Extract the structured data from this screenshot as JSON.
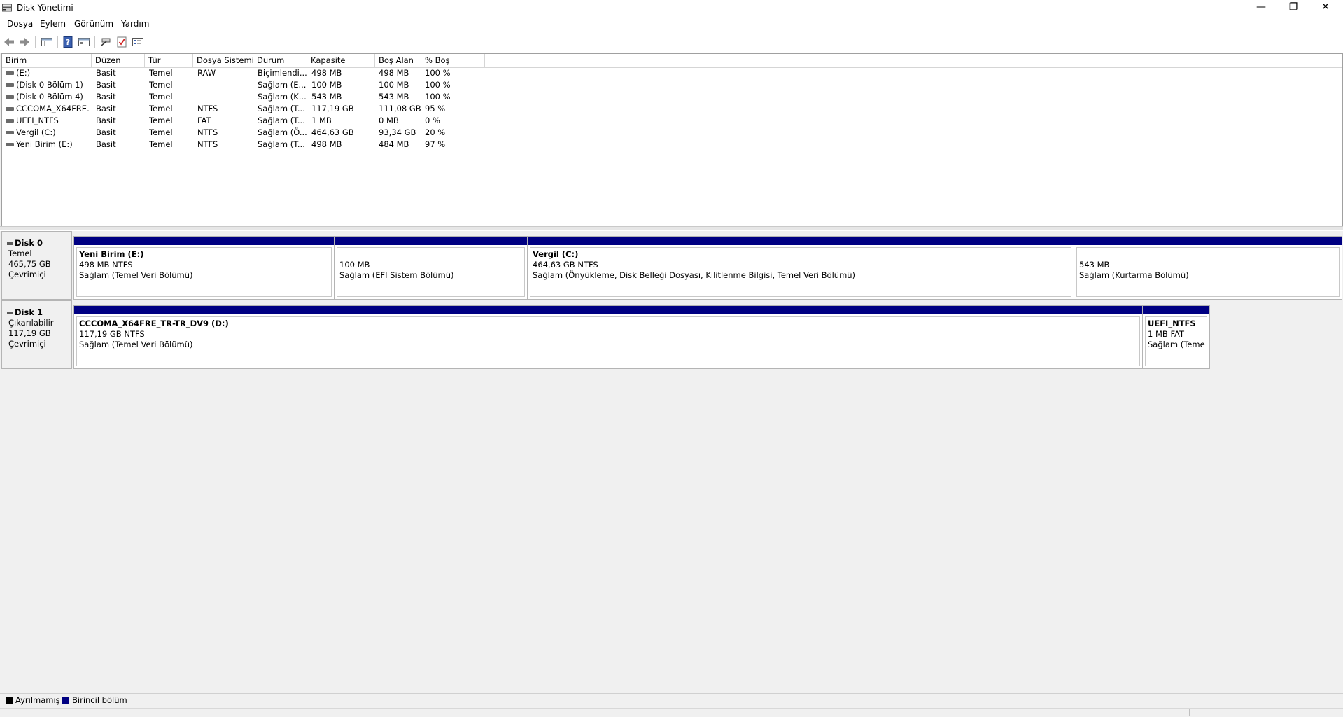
{
  "window": {
    "title": "Disk Yönetimi",
    "minimize_glyph": "—",
    "restore_glyph": "❐",
    "close_glyph": "✕"
  },
  "menu": [
    "Dosya",
    "Eylem",
    "Görünüm",
    "Yardım"
  ],
  "toolbar": {
    "icons": [
      "back-icon",
      "forward-icon",
      "console-tree-icon",
      "help-icon",
      "properties-icon",
      "connect-icon",
      "check-icon",
      "settings-list-icon"
    ]
  },
  "volume_list": {
    "columns": [
      "Birim",
      "Düzen",
      "Tür",
      "Dosya Sistemi",
      "Durum",
      "Kapasite",
      "Boş Alan",
      "% Boş"
    ],
    "rows": [
      [
        "(E:)",
        "Basit",
        "Temel",
        "RAW",
        "Biçimlendi...",
        "498 MB",
        "498 MB",
        "100 %"
      ],
      [
        "(Disk 0 Bölüm 1)",
        "Basit",
        "Temel",
        "",
        "Sağlam (E...",
        "100 MB",
        "100 MB",
        "100 %"
      ],
      [
        "(Disk 0 Bölüm 4)",
        "Basit",
        "Temel",
        "",
        "Sağlam (K...",
        "543 MB",
        "543 MB",
        "100 %"
      ],
      [
        "CCCOMA_X64FRE...",
        "Basit",
        "Temel",
        "NTFS",
        "Sağlam (T...",
        "117,19 GB",
        "111,08 GB",
        "95 %"
      ],
      [
        "UEFI_NTFS",
        "Basit",
        "Temel",
        "FAT",
        "Sağlam (T...",
        "1 MB",
        "0 MB",
        "0 %"
      ],
      [
        "Vergil (C:)",
        "Basit",
        "Temel",
        "NTFS",
        "Sağlam (Ö...",
        "464,63 GB",
        "93,34 GB",
        "20 %"
      ],
      [
        "Yeni Birim (E:)",
        "Basit",
        "Temel",
        "NTFS",
        "Sağlam (T...",
        "498 MB",
        "484 MB",
        "97 %"
      ]
    ]
  },
  "disks": [
    {
      "name": "Disk 0",
      "type": "Temel",
      "size": "465,75 GB",
      "status": "Çevrimiçi",
      "partitions": [
        {
          "title": "Yeni Birim  (E:)",
          "size_fs": "498 MB NTFS",
          "status": "Sağlam (Temel Veri Bölümü)"
        },
        {
          "title": "",
          "size_fs": "100 MB",
          "status": "Sağlam (EFI Sistem Bölümü)"
        },
        {
          "title": "Vergil  (C:)",
          "size_fs": "464,63 GB NTFS",
          "status": "Sağlam (Önyükleme, Disk Belleği Dosyası, Kilitlenme Bilgisi, Temel Veri Bölümü)"
        },
        {
          "title": "",
          "size_fs": "543 MB",
          "status": "Sağlam (Kurtarma Bölümü)"
        }
      ]
    },
    {
      "name": "Disk 1",
      "type": "Çıkarılabilir",
      "size": "117,19 GB",
      "status": "Çevrimiçi",
      "partitions": [
        {
          "title": "CCCOMA_X64FRE_TR-TR_DV9  (D:)",
          "size_fs": "117,19 GB NTFS",
          "status": "Sağlam (Temel Veri Bölümü)"
        },
        {
          "title": "UEFI_NTFS",
          "size_fs": "1 MB FAT",
          "status": "Sağlam (Teme"
        }
      ]
    }
  ],
  "legend": [
    {
      "label": "Ayrılmamış",
      "color": "#000000"
    },
    {
      "label": "Birincil bölüm",
      "color": "#000082"
    }
  ]
}
